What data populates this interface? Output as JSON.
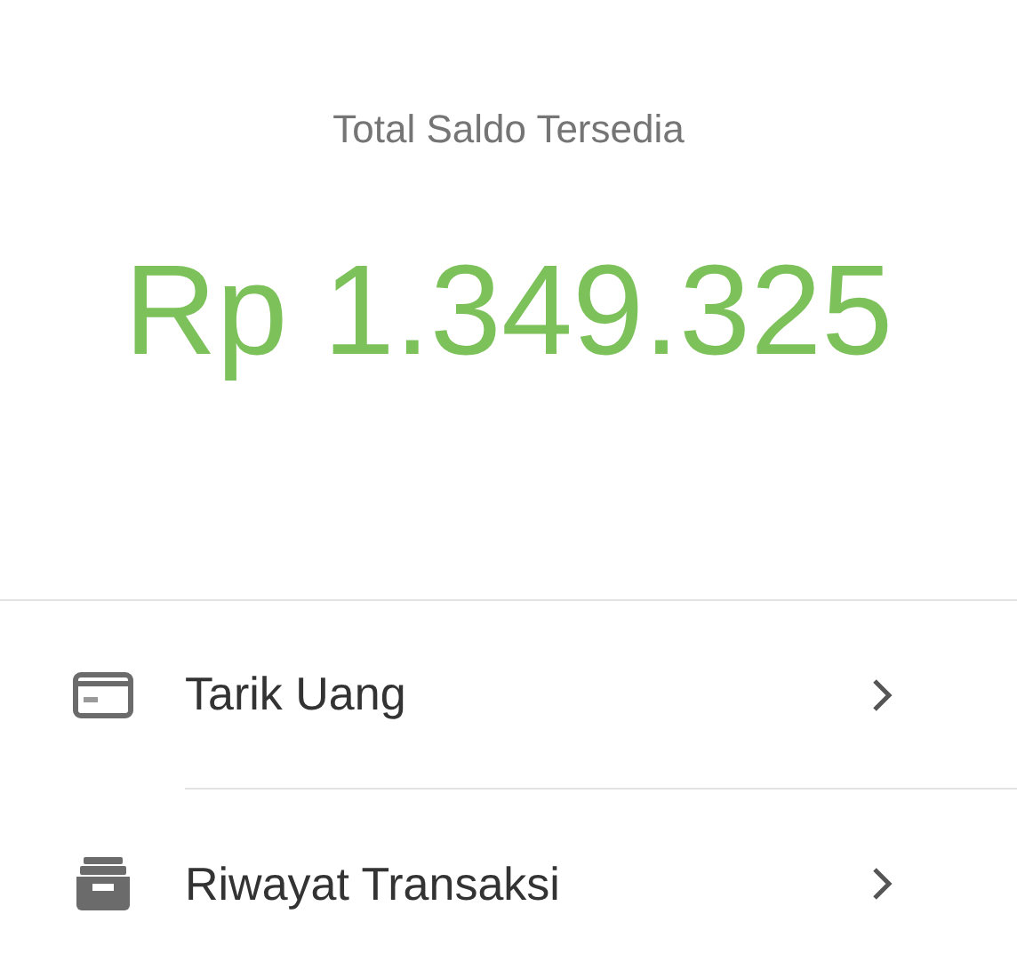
{
  "balance": {
    "label": "Total Saldo Tersedia",
    "amount": "Rp 1.349.325"
  },
  "menu": [
    {
      "kind": "card",
      "label": "Tarik Uang"
    },
    {
      "kind": "archive",
      "label": "Riwayat Transaksi"
    }
  ]
}
